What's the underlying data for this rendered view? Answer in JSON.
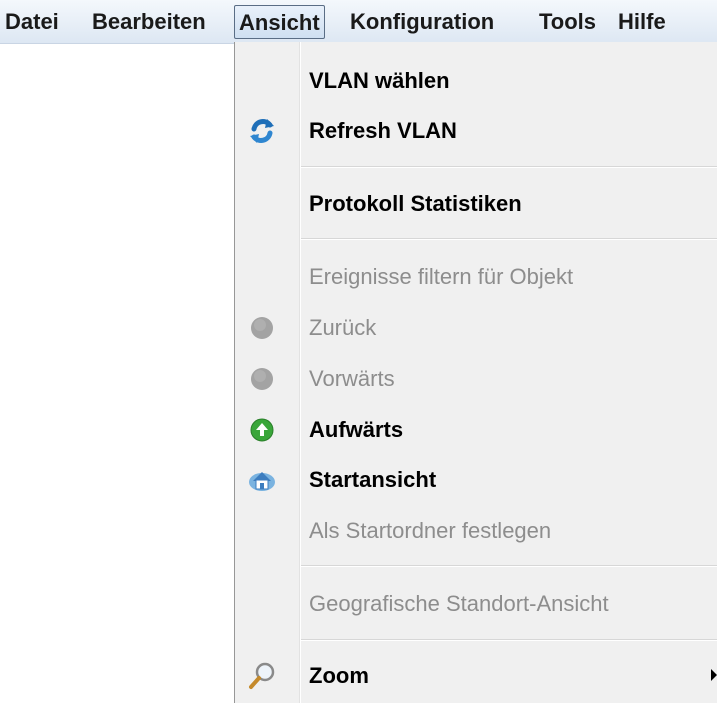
{
  "menubar": {
    "items": [
      {
        "label": "Datei"
      },
      {
        "label": "Bearbeiten"
      },
      {
        "label": "Ansicht",
        "active": true
      },
      {
        "label": "Konfiguration"
      },
      {
        "label": "Tools"
      },
      {
        "label": "Hilfe"
      }
    ]
  },
  "dropdown": {
    "items": [
      {
        "label": "VLAN wählen",
        "enabled": true,
        "icon": null
      },
      {
        "label": "Refresh VLAN",
        "enabled": true,
        "icon": "refresh-icon"
      },
      {
        "label": "Protokoll Statistiken",
        "enabled": true,
        "icon": null
      },
      {
        "label": "Ereignisse filtern für Objekt",
        "enabled": false,
        "icon": null
      },
      {
        "label": "Zurück",
        "enabled": false,
        "icon": "back-icon"
      },
      {
        "label": "Vorwärts",
        "enabled": false,
        "icon": "forward-icon"
      },
      {
        "label": "Aufwärts",
        "enabled": true,
        "icon": "up-icon"
      },
      {
        "label": "Startansicht",
        "enabled": true,
        "icon": "home-icon"
      },
      {
        "label": "Als Startordner festlegen",
        "enabled": false,
        "icon": null
      },
      {
        "label": "Geografische Standort-Ansicht",
        "enabled": false,
        "icon": null
      },
      {
        "label": "Zoom",
        "enabled": true,
        "icon": "zoom-icon",
        "submenu": true
      }
    ]
  },
  "colors": {
    "disabled_text": "#8d8d8d",
    "menu_background": "#f0f0f0",
    "up_icon": "#3aa63a",
    "refresh_icon": "#1f6fb8"
  }
}
